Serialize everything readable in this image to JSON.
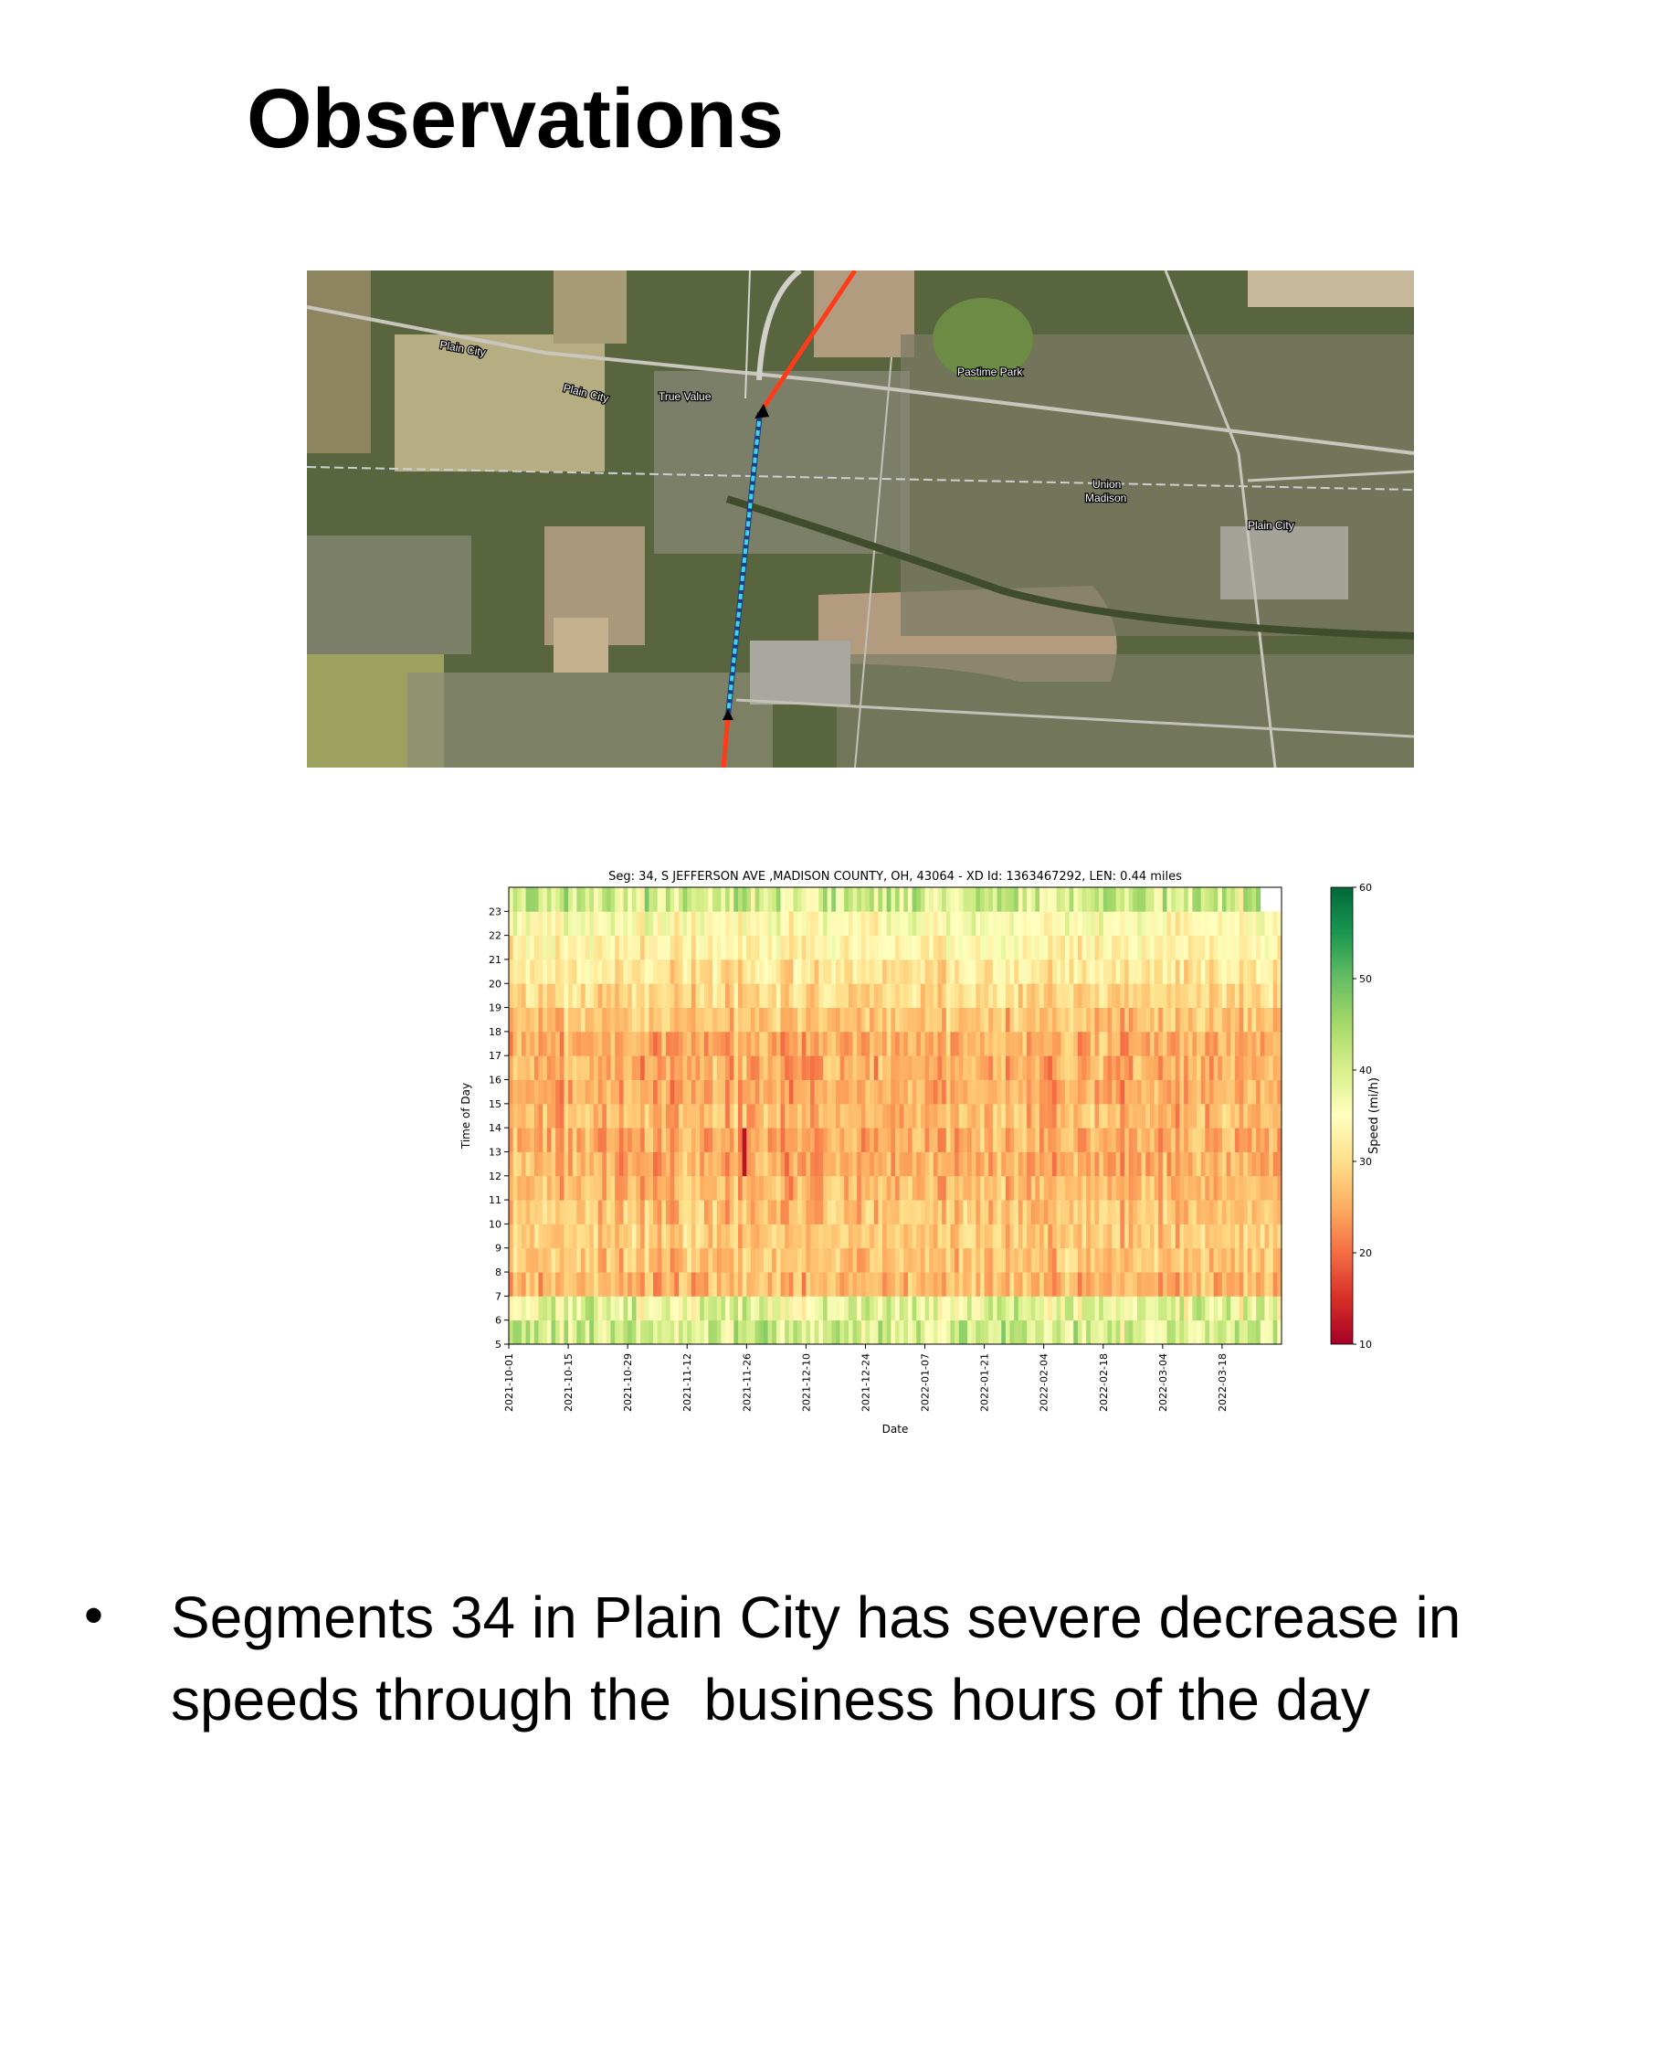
{
  "slide": {
    "title": "Observations",
    "bullet": "Segments 34 in Plain City has severe decrease in speeds through the  business hours of the day"
  },
  "map": {
    "labels": [
      {
        "text": "Plain City",
        "name": "map-label-plain-city-road"
      },
      {
        "text": "Plain City",
        "name": "map-label-plain-city-road-2"
      },
      {
        "text": "True Value",
        "name": "map-label-true-value"
      },
      {
        "text": "Pastime Park",
        "name": "map-label-pastime-park"
      },
      {
        "text": "Union",
        "name": "map-label-union"
      },
      {
        "text": "Madison",
        "name": "map-label-madison"
      },
      {
        "text": "Plain City",
        "name": "map-label-plain-city"
      }
    ],
    "colors": {
      "segment": "#3fd6e0",
      "adjacent": "#ff3b1a"
    }
  },
  "chart_data": {
    "type": "heatmap",
    "title": "Seg: 34, S JEFFERSON AVE ,MADISON COUNTY, OH, 43064 - XD Id: 1363467292, LEN: 0.44 miles",
    "xlabel": "Date",
    "ylabel": "Time of Day",
    "x_range": [
      "2021-10-01",
      "2022-03-31"
    ],
    "x_ticks": [
      "2021-10-01",
      "2021-10-15",
      "2021-10-29",
      "2021-11-12",
      "2021-11-26",
      "2021-12-10",
      "2021-12-24",
      "2022-01-07",
      "2022-01-21",
      "2022-02-04",
      "2022-02-18",
      "2022-03-04",
      "2022-03-18"
    ],
    "y_ticks": [
      5,
      6,
      7,
      8,
      9,
      10,
      11,
      12,
      13,
      14,
      15,
      16,
      17,
      18,
      19,
      20,
      21,
      22,
      23
    ],
    "y_range": [
      5,
      24
    ],
    "colorbar": {
      "label": "Speed (mi/h)",
      "min": 10,
      "max": 60,
      "ticks": [
        10,
        20,
        30,
        40,
        50,
        60
      ],
      "colormap": "RdYlGn"
    },
    "hourly_typical_speed": [
      {
        "hour": 5,
        "speed": 40
      },
      {
        "hour": 6,
        "speed": 38
      },
      {
        "hour": 7,
        "speed": 26
      },
      {
        "hour": 8,
        "speed": 27
      },
      {
        "hour": 9,
        "speed": 28
      },
      {
        "hour": 10,
        "speed": 27
      },
      {
        "hour": 11,
        "speed": 26
      },
      {
        "hour": 12,
        "speed": 25
      },
      {
        "hour": 13,
        "speed": 25
      },
      {
        "hour": 14,
        "speed": 26
      },
      {
        "hour": 15,
        "speed": 25
      },
      {
        "hour": 16,
        "speed": 25
      },
      {
        "hour": 17,
        "speed": 25
      },
      {
        "hour": 18,
        "speed": 27
      },
      {
        "hour": 19,
        "speed": 29
      },
      {
        "hour": 20,
        "speed": 31
      },
      {
        "hour": 21,
        "speed": 33
      },
      {
        "hour": 22,
        "speed": 35
      },
      {
        "hour": 23,
        "speed": 40
      }
    ],
    "notable_cells": [
      {
        "date": "2021-11-25",
        "hour": 12,
        "speed": 12
      }
    ]
  }
}
